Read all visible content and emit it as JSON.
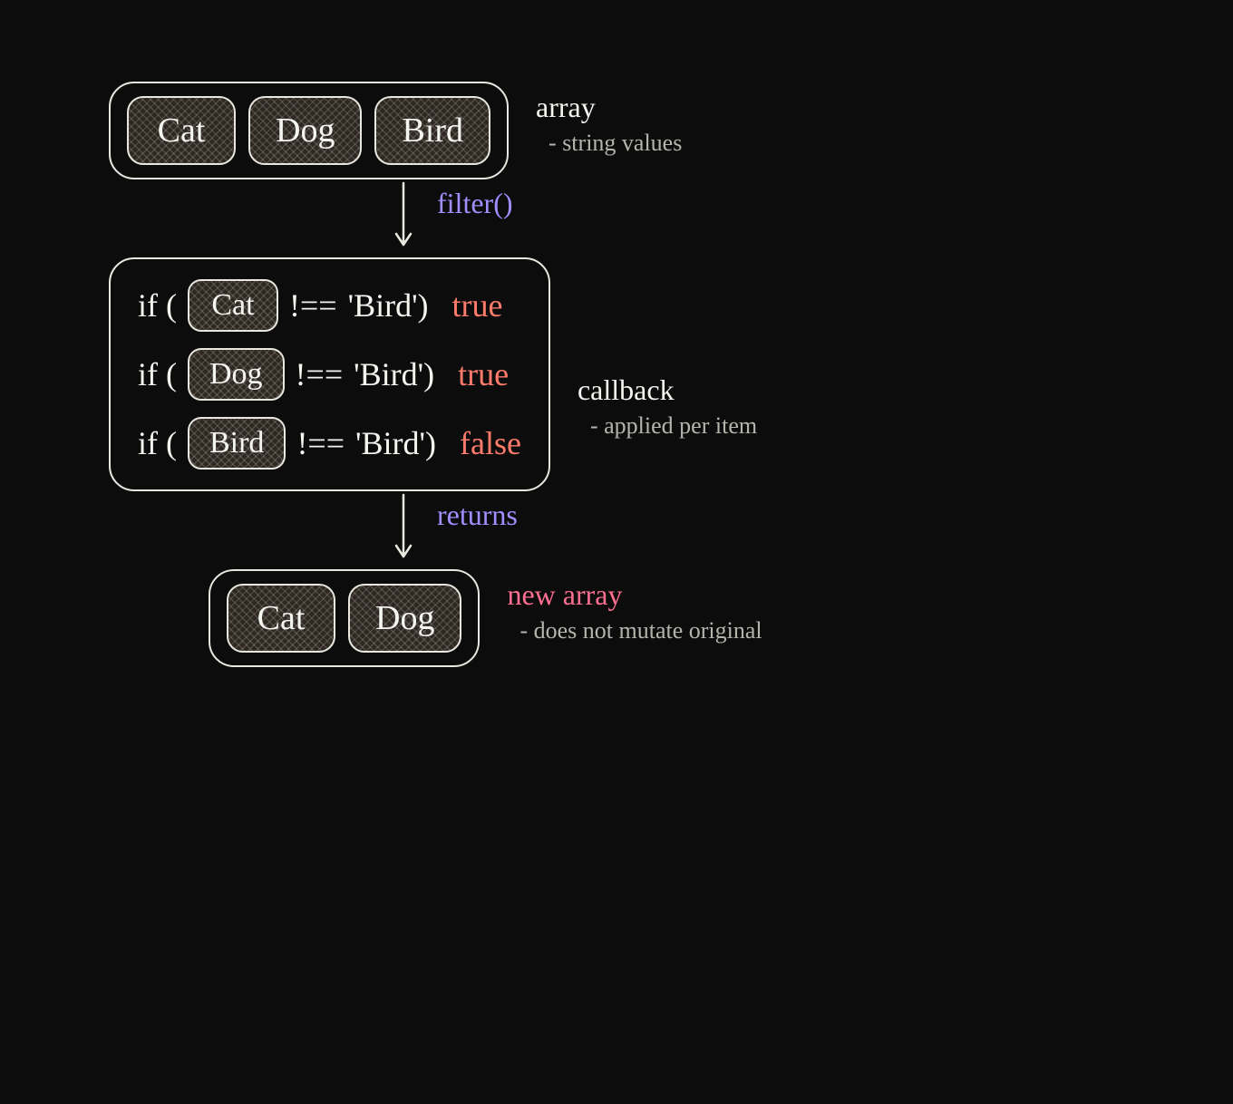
{
  "array": {
    "items": [
      "Cat",
      "Dog",
      "Bird"
    ],
    "anno_title": "array",
    "anno_sub": "string values"
  },
  "connector1": {
    "label": "filter()"
  },
  "callback": {
    "if_open": "if (",
    "operator": "!==",
    "compare": "'Bird')",
    "rows": [
      {
        "val": "Cat",
        "result": "true"
      },
      {
        "val": "Dog",
        "result": "true"
      },
      {
        "val": "Bird",
        "result": "false"
      }
    ],
    "anno_title": "callback",
    "anno_sub": "applied per item"
  },
  "connector2": {
    "label": "returns"
  },
  "result": {
    "items": [
      "Cat",
      "Dog"
    ],
    "anno_title": "new array",
    "anno_sub": "does not mutate original"
  },
  "colors": {
    "accent_purple": "#9f8fff",
    "accent_red": "#ff7b6b",
    "accent_pink": "#ff6f91"
  }
}
